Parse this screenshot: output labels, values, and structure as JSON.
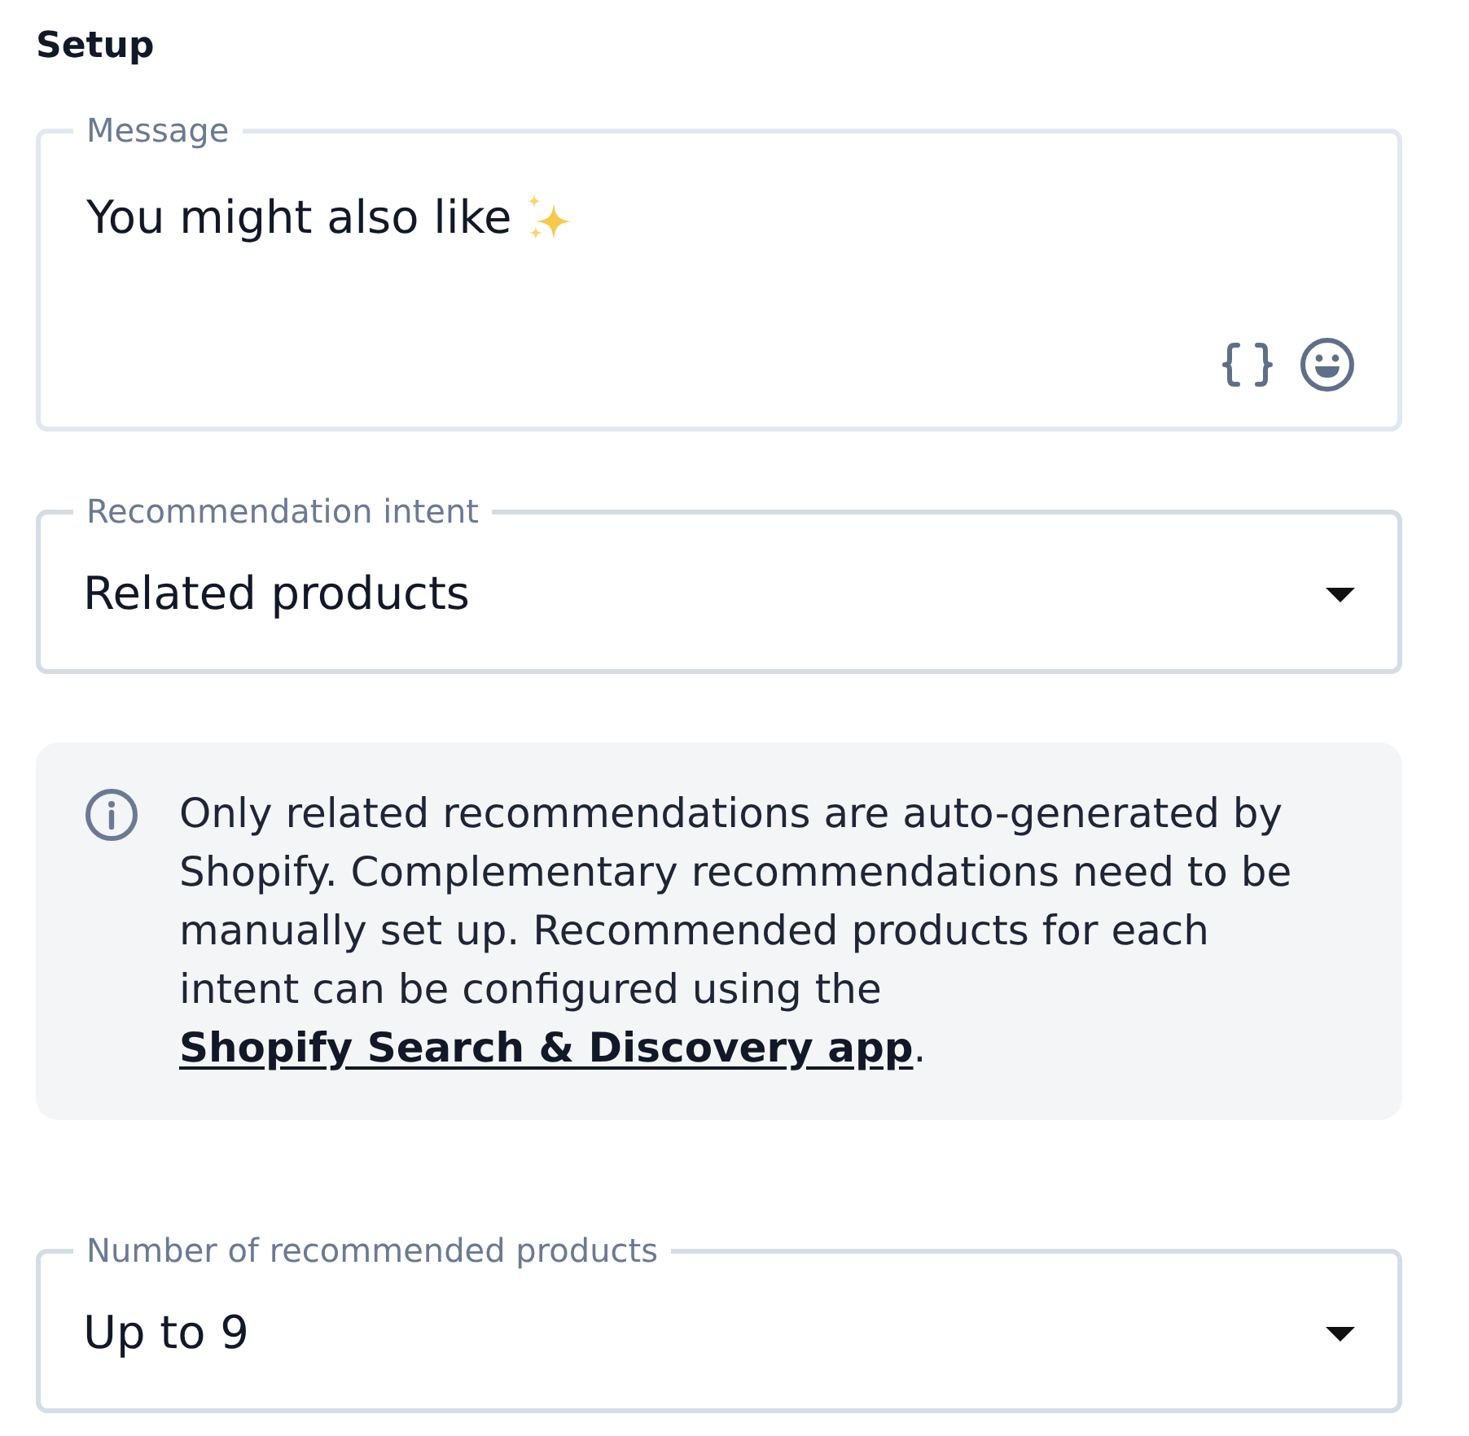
{
  "heading": "Setup",
  "blocks": [
    {
      "kind": "text",
      "label": "Message",
      "value": "You might also like"
    },
    {
      "kind": "select",
      "label": "Recommendation intent",
      "value": "Related products"
    },
    {
      "kind": "notice",
      "text": "Only related recommendations are auto-generated by Shopify. Complementary recommendations need to be manually set up. Recommended products for each intent can be configured using the",
      "link": "Shopify Search & Discovery app",
      "end": "."
    },
    {
      "kind": "select",
      "label": "Number of recommended products",
      "value": "Up to 9"
    }
  ]
}
